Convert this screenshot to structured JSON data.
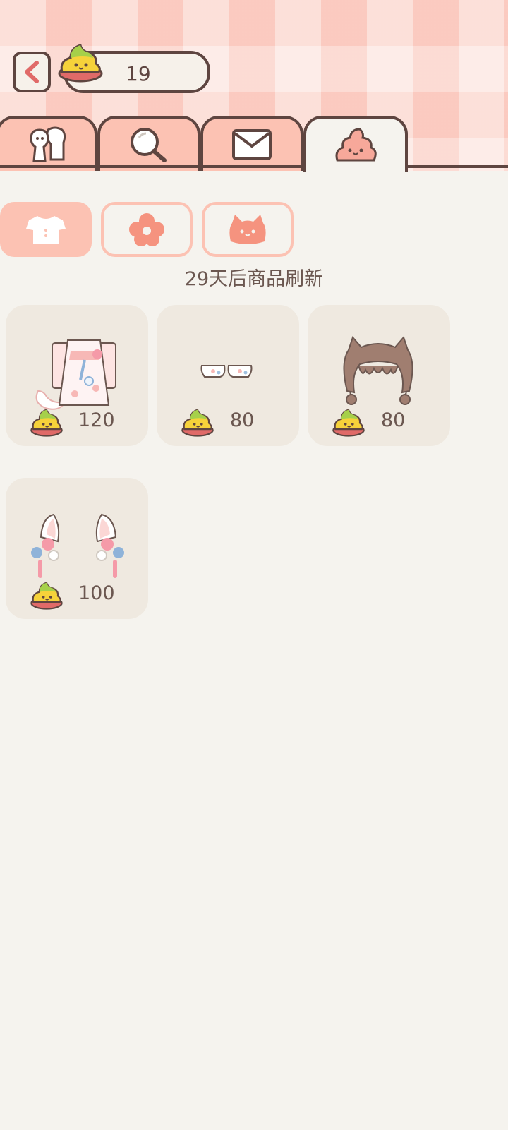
{
  "currency": {
    "value": "19",
    "icon": "poop-coin-icon"
  },
  "tabs": [
    {
      "name": "friends",
      "icon": "friends-icon"
    },
    {
      "name": "search",
      "icon": "magnifier-icon"
    },
    {
      "name": "mail",
      "icon": "envelope-icon"
    },
    {
      "name": "shop",
      "icon": "poop-face-icon",
      "active": true
    }
  ],
  "subtabs": [
    {
      "name": "clothes",
      "icon": "shirt-icon",
      "active": true
    },
    {
      "name": "accessories",
      "icon": "flower-icon"
    },
    {
      "name": "hair",
      "icon": "cat-head-icon"
    }
  ],
  "refresh_text": "29天后商品刷新",
  "items": [
    {
      "name": "pink-white-outfit",
      "icon": "outfit-icon",
      "price": "120"
    },
    {
      "name": "pink-socks",
      "icon": "socks-icon",
      "price": "80"
    },
    {
      "name": "brown-cat-ear-hair",
      "icon": "hair-icon",
      "price": "80"
    },
    {
      "name": "white-ears-with-flowers",
      "icon": "ear-accessory-icon",
      "price": "100"
    }
  ],
  "colors": {
    "header_bg": "#fbd5cb",
    "page_bg": "#f5f3ee",
    "tab_bg": "#fcc2b3",
    "outline": "#5e4540",
    "card_bg": "#efe9e0",
    "accent_red": "#e06a68"
  }
}
